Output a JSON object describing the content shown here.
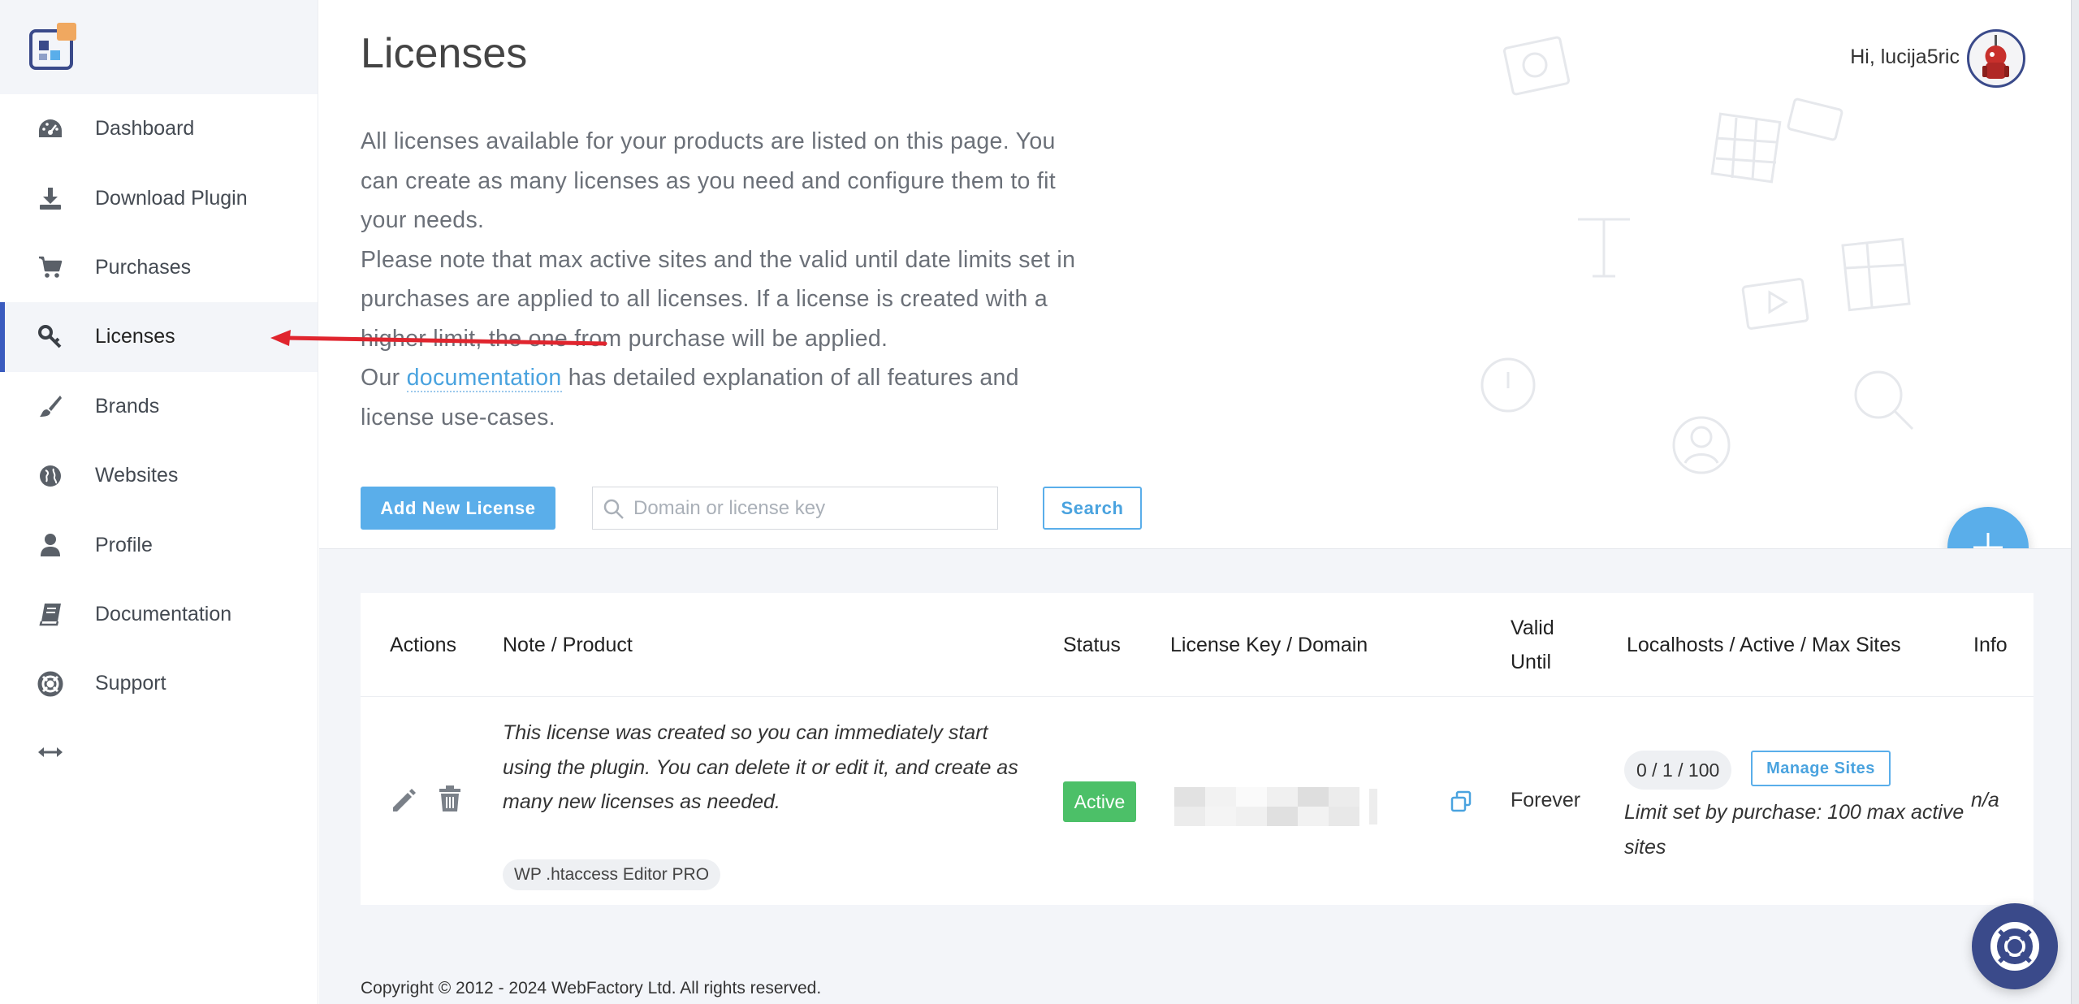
{
  "sidebar": {
    "items": [
      {
        "label": "Dashboard",
        "icon": "dashboard-icon"
      },
      {
        "label": "Download Plugin",
        "icon": "download-icon"
      },
      {
        "label": "Purchases",
        "icon": "cart-icon"
      },
      {
        "label": "Licenses",
        "icon": "key-icon",
        "active": true
      },
      {
        "label": "Brands",
        "icon": "brush-icon"
      },
      {
        "label": "Websites",
        "icon": "globe-icon"
      },
      {
        "label": "Profile",
        "icon": "user-icon"
      },
      {
        "label": "Documentation",
        "icon": "book-icon"
      },
      {
        "label": "Support",
        "icon": "lifebuoy-icon"
      }
    ]
  },
  "header": {
    "title": "Licenses",
    "greeting": "Hi, lucija5ric"
  },
  "intro": {
    "line1": "All licenses available for your products are listed on this page. You can create as many licenses as you need and configure them to fit your needs.",
    "line2": "Please note that max active sites and the valid until date limits set in purchases are applied to all licenses. If a license is created with a higher limit, the one from purchase will be applied.",
    "line3_prefix": "Our",
    "line3_link": "documentation",
    "line3_suffix": "has detailed explanation of all features and license use-cases."
  },
  "toolbar": {
    "add_label": "Add New License",
    "search_placeholder": "Domain or license key",
    "search_label": "Search"
  },
  "table": {
    "headers": {
      "actions": "Actions",
      "note": "Note / Product",
      "status": "Status",
      "key": "License Key / Domain",
      "valid": "Valid Until",
      "sites": "Localhosts / Active / Max Sites",
      "info": "Info"
    },
    "rows": [
      {
        "note": "This license was created so you can immediately start using the plugin. You can delete it or edit it, and create as many new licenses as needed.",
        "product": "WP .htaccess Editor PRO",
        "status": "Active",
        "valid": "Forever",
        "sites": "0 / 1 / 100",
        "manage_label": "Manage Sites",
        "limit": "Limit set by purchase: 100 max active sites",
        "info": "n/a"
      }
    ]
  },
  "footer": {
    "copyright": "Copyright © 2012 - 2024 WebFactory Ltd. All rights reserved."
  },
  "colors": {
    "accent": "#5aaeea",
    "active_status": "#4cc068",
    "nav_indicator": "#3a5bbf",
    "help_fab": "#3a4a8a",
    "annotation": "#e0252e"
  }
}
